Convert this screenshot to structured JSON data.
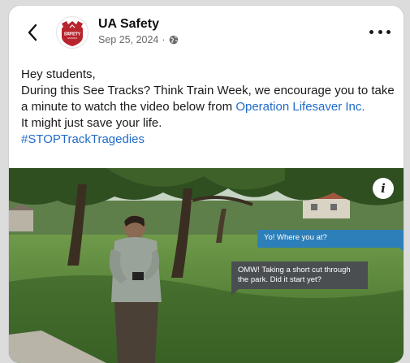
{
  "header": {
    "page_name": "UA Safety",
    "date": "Sep 25, 2024",
    "separator": "·",
    "icons": {
      "back": "chevron-left-icon",
      "avatar": "ua-safety-shield-logo",
      "privacy": "globe-icon",
      "more": "more-dots-icon"
    },
    "avatar_text": "SAFETY"
  },
  "post": {
    "greeting": "Hey students,",
    "body_pre_link": "During this See Tracks? Think Train Week, we encourage you to take a minute to watch the video below from ",
    "link_text": "Operation Lifesaver Inc.",
    "line_after": "It might just save your life.",
    "hashtag": "#STOPTrackTragedies"
  },
  "video": {
    "info_label": "i",
    "bubble_received": "Yo! Where you at?",
    "bubble_sent": "OMW! Taking a short cut through the park. Did it start yet?"
  },
  "colors": {
    "link": "#1f6bc9",
    "brand_red": "#b8242e",
    "bubble_blue": "#2d7fb9",
    "bubble_gray": "#4b4e51"
  }
}
